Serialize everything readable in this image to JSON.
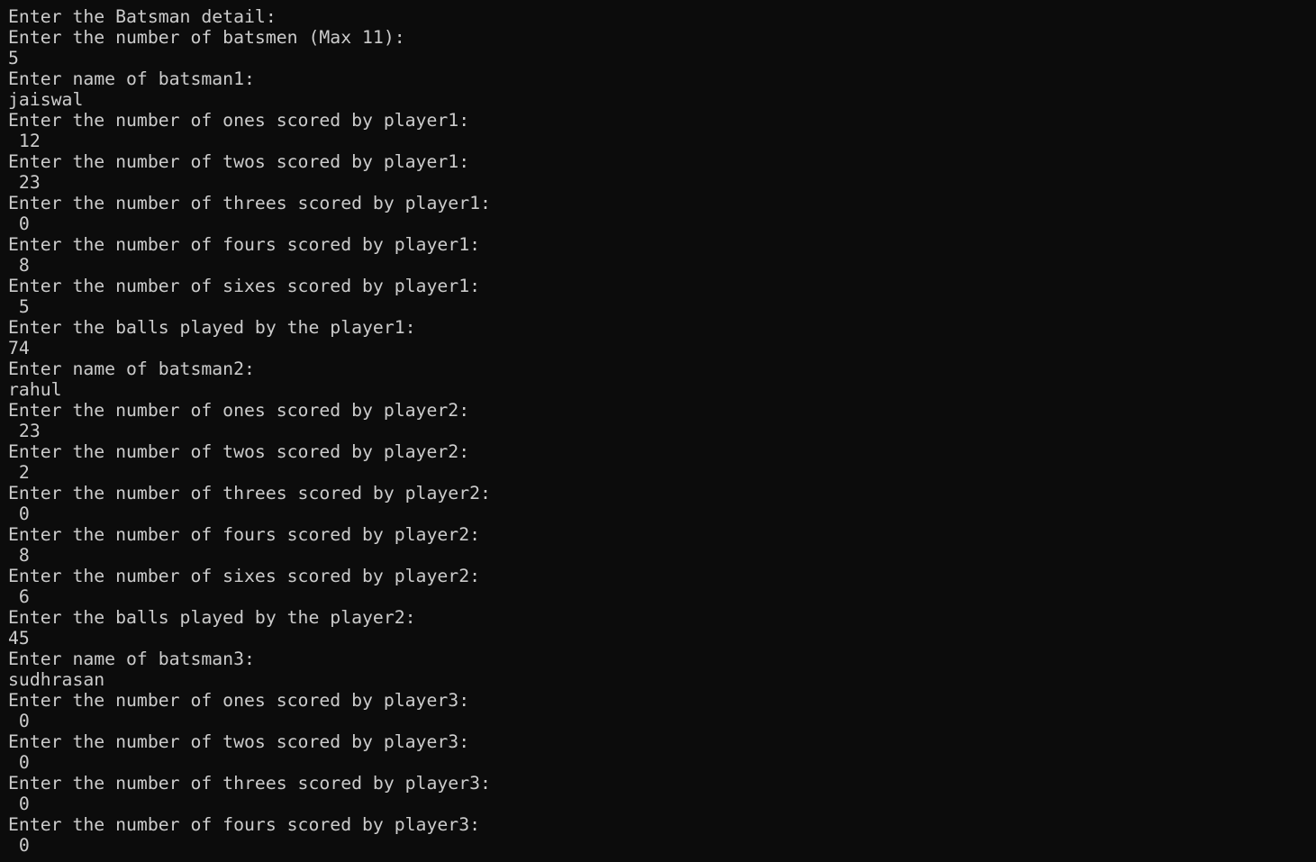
{
  "terminal": {
    "lines": [
      "Enter the Batsman detail:",
      "Enter the number of batsmen (Max 11):",
      "5",
      "Enter name of batsman1:",
      "jaiswal",
      "Enter the number of ones scored by player1:",
      " 12",
      "Enter the number of twos scored by player1:",
      " 23",
      "Enter the number of threes scored by player1:",
      " 0",
      "Enter the number of fours scored by player1:",
      " 8",
      "Enter the number of sixes scored by player1:",
      " 5",
      "Enter the balls played by the player1:",
      "74",
      "Enter name of batsman2:",
      "rahul",
      "Enter the number of ones scored by player2:",
      " 23",
      "Enter the number of twos scored by player2:",
      " 2",
      "Enter the number of threes scored by player2:",
      " 0",
      "Enter the number of fours scored by player2:",
      " 8",
      "Enter the number of sixes scored by player2:",
      " 6",
      "Enter the balls played by the player2:",
      "45",
      "Enter name of batsman3:",
      "sudhrasan",
      "Enter the number of ones scored by player3:",
      " 0",
      "Enter the number of twos scored by player3:",
      " 0",
      "Enter the number of threes scored by player3:",
      " 0",
      "Enter the number of fours scored by player3:",
      " 0"
    ]
  }
}
